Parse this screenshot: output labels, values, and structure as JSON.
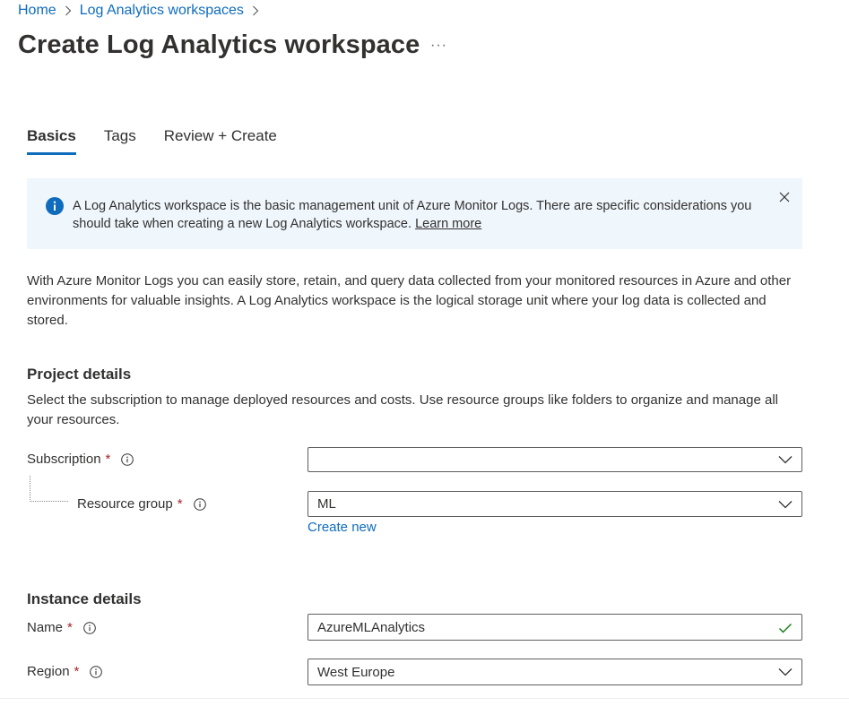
{
  "breadcrumb": {
    "items": [
      "Home",
      "Log Analytics workspaces"
    ]
  },
  "page": {
    "title": "Create Log Analytics workspace",
    "more_label": "···"
  },
  "tabs": [
    {
      "label": "Basics",
      "active": true
    },
    {
      "label": "Tags",
      "active": false
    },
    {
      "label": "Review + Create",
      "active": false
    }
  ],
  "banner": {
    "text": "A Log Analytics workspace is the basic management unit of Azure Monitor Logs. There are specific considerations you should take when creating a new Log Analytics workspace.",
    "link": "Learn more"
  },
  "intro": "With Azure Monitor Logs you can easily store, retain, and query data collected from your monitored resources in Azure and other environments for valuable insights. A Log Analytics workspace is the logical storage unit where your log data is collected and stored.",
  "project": {
    "heading": "Project details",
    "description": "Select the subscription to manage deployed resources and costs. Use resource groups like folders to organize and manage all your resources.",
    "subscription_label": "Subscription",
    "subscription_value": "",
    "resource_group_label": "Resource group",
    "resource_group_value": "ML",
    "create_new": "Create new"
  },
  "instance": {
    "heading": "Instance details",
    "name_label": "Name",
    "name_value": "AzureMLAnalytics",
    "region_label": "Region",
    "region_value": "West Europe"
  },
  "required_mark": "*",
  "colors": {
    "accent": "#0f6cbd",
    "banner_bg": "#eff6fc",
    "required": "#a4262c",
    "valid": "#107c10"
  }
}
